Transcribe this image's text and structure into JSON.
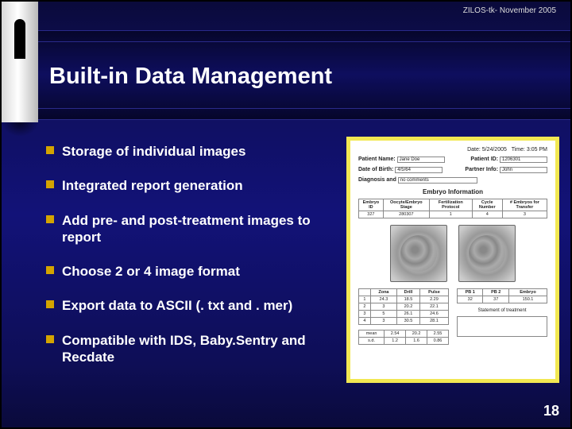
{
  "header": {
    "date_label": "ZILOS-tk- November 2005"
  },
  "title": "Built-in Data Management",
  "bullets": [
    "Storage of individual images",
    "Integrated report generation",
    "Add pre- and post-treatment images to report",
    "Choose 2 or 4 image format",
    "Export data to ASCII (. txt and . mer)",
    "Compatible with IDS, Baby.Sentry and Recdate"
  ],
  "report": {
    "date": "Date: 5/24/2005",
    "time": "Time: 3:05 PM",
    "patient_name_label": "Patient Name:",
    "patient_name": "Jane Doe",
    "patient_id_label": "Patient ID:",
    "patient_id": "1206301",
    "dob_label": "Date of Birth:",
    "dob": "4/5/64",
    "partner_label": "Partner Info:",
    "partner": "John",
    "diag_label": "Diagnosis and",
    "diag_val": "no comments",
    "section": "Embryo Information",
    "t1_headers": [
      "Embryo ID",
      "Oocyte/Embryo Stage",
      "Fertilization Protocol",
      "Cycle Number",
      "# Embryos for Transfer"
    ],
    "t1_row": [
      "327",
      "280307",
      "1",
      "4",
      "3"
    ],
    "t2a_headers": [
      "Zona",
      "Drill",
      "Pulse"
    ],
    "t2a_rows": [
      [
        "1",
        "24.3",
        "18.5",
        "2.29"
      ],
      [
        "2",
        "3",
        "20.2",
        "22.1"
      ],
      [
        "3",
        "5",
        "26.1",
        "24.6"
      ],
      [
        "4",
        "3",
        "30.5",
        "28.1"
      ]
    ],
    "t2b_headers": [
      "PB 1",
      "PB 2",
      "Embryo"
    ],
    "t2b_rows": [
      [
        "32",
        "37",
        "150.1"
      ]
    ],
    "stmt": "Statement of treatment",
    "mean_label": "mean",
    "mean_row": [
      "2.54",
      "20.2",
      "2.55"
    ],
    "sd_label": "s.d.",
    "sd_row": [
      "1.2",
      "1.6",
      "0.86"
    ]
  },
  "page_number": "18"
}
